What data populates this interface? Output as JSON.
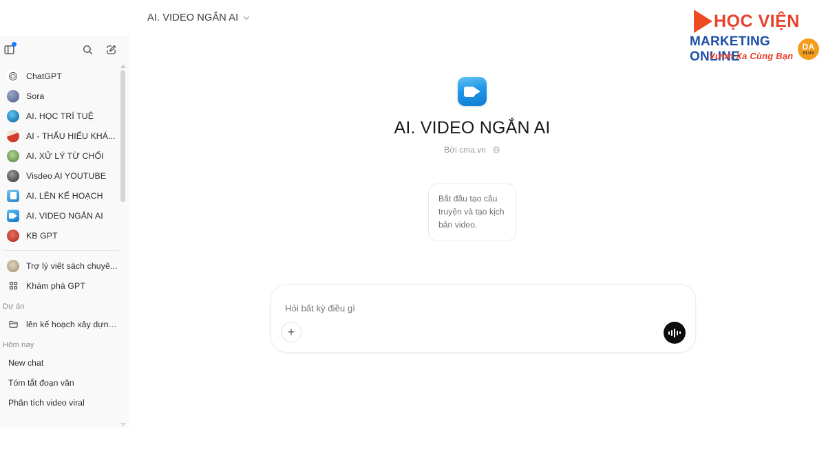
{
  "sidebar": {
    "header": {
      "panel_toggle_icon": "sidebar-panel-icon",
      "panel_badge": "blue-dot",
      "search_icon": "search-icon",
      "new_chat_icon": "compose-pencil-icon"
    },
    "gpt_items": [
      {
        "label": "ChatGPT",
        "icon": "chatgpt-logo-avatar",
        "color": "#ffffff",
        "shape": "circle"
      },
      {
        "label": "Sora",
        "icon": "sora-avatar",
        "color": "#6b7ba8",
        "shape": "circle"
      },
      {
        "label": "AI. HỌC TRÍ TUỆ",
        "icon": "brain-avatar",
        "color": "#1b6fb5",
        "shape": "circle"
      },
      {
        "label": "AI - THẤU HIỂU KHÁ...",
        "icon": "person-avatar",
        "color": "#d94b3a",
        "shape": "circle"
      },
      {
        "label": "AI. XỬ LÝ TỪ CHỐI",
        "icon": "cartoon-avatar",
        "color": "#6fae5f",
        "shape": "circle"
      },
      {
        "label": "Visdeo AI YOUTUBE",
        "icon": "camera-person-avatar",
        "color": "#4a4a4a",
        "shape": "circle"
      },
      {
        "label": "AI. LÊN KẾ HOẠCH",
        "icon": "clipboard-avatar",
        "color": "#3fa0dd",
        "shape": "square"
      },
      {
        "label": "AI. VIDEO NGẮN AI",
        "icon": "video-camera-avatar",
        "color": "#1f93e0",
        "shape": "square"
      },
      {
        "label": "KB GPT",
        "icon": "red-mascot-avatar",
        "color": "#c0392b",
        "shape": "circle"
      }
    ],
    "explore_items": [
      {
        "label": "Trợ lý viết sách chuyê...",
        "icon": "book-assistant-avatar",
        "color": "#b8a88a",
        "shape": "circle"
      },
      {
        "label": "Khám phá GPT",
        "icon": "grid-dots-icon",
        "color": "",
        "shape": "grid"
      }
    ],
    "projects": {
      "section_label": "Dự án",
      "items": [
        {
          "label": "lên kế hoạch xây dựng k...",
          "icon": "folder-icon"
        }
      ]
    },
    "history": {
      "section_label": "Hôm nay",
      "items": [
        {
          "label": "New chat"
        },
        {
          "label": "Tóm tắt đoạn văn"
        },
        {
          "label": "Phân tích video viral"
        }
      ]
    }
  },
  "topbar": {
    "gpt_name": "AI. VIDEO NGẮN AI",
    "chevron_icon": "chevron-down-icon"
  },
  "hero": {
    "icon": "video-camera-icon",
    "title": "AI. VIDEO NGẮN AI",
    "byline": "Bởi cma.vn",
    "globe_icon": "globe-icon"
  },
  "suggestions": [
    {
      "text": "Bắt đầu tạo câu truyện và tạo kịch bản video."
    }
  ],
  "composer": {
    "placeholder": "Hỏi bất kỳ điều gì",
    "value": "",
    "add_icon": "plus-icon",
    "voice_icon": "voice-waveform-icon"
  },
  "watermark": {
    "line1": "HỌC VIỆN",
    "line2": "MARKETING ONLINE",
    "line3": "Vươn Xa Cùng Bạn",
    "badge_top": "DA",
    "badge_bottom": "PLUS",
    "play_icon": "play-triangle-icon"
  },
  "colors": {
    "sidebar_bg": "#f9f9f9",
    "accent_blue": "#1a7aff",
    "logo_red": "#e8402a",
    "logo_blue": "#1b4ea8",
    "logo_orange": "#f59b1c",
    "voice_btn": "#0d0d0d"
  }
}
